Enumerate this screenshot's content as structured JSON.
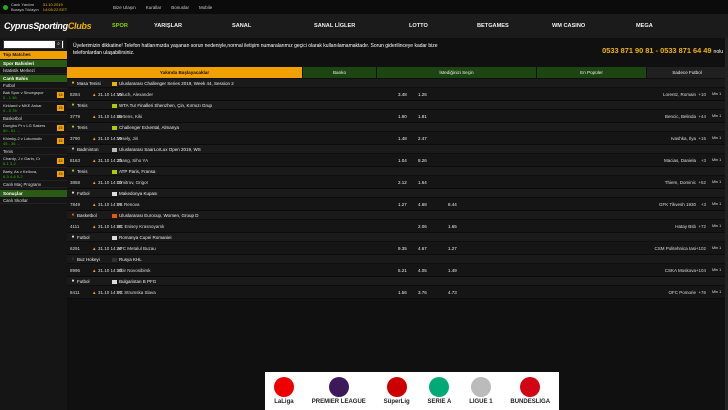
{
  "topbar": {
    "live_help_line1": "Canlı Yardım",
    "live_help_line2": "Buraya Tıklayın",
    "date": "31.10.2019",
    "time": "14:08:22 EET",
    "links": [
      "Bize Ulaşın",
      "Kurallar",
      "Bonuslar",
      "Mobile"
    ]
  },
  "header": {
    "logo_part1": "Cyprus",
    "logo_part2": "Sporting",
    "logo_part3": "Clubs",
    "nav": [
      "SPOR",
      "YARIŞLAR",
      "SANAL",
      "SANAL LİGLER",
      "LOTTO",
      "BETGAMES",
      "WM CASINO",
      "MEGA"
    ]
  },
  "sidebar": {
    "search_placeholder": "",
    "top_matches_label": "Top Matches",
    "top_items": [
      "Spor Bahisleri",
      "İstatistik Merkezi"
    ],
    "live_bets_label": "Canlı Bahis",
    "live_sport": "Futbol",
    "live_matches": [
      {
        "name": "Bak Spor v Sincegspor",
        "score": "0 - 1 36",
        "badge": "15"
      },
      {
        "name": "Kirkland v MKE Ankar",
        "score": "0 - 0 78",
        "badge": "15"
      },
      {
        "name": "Basketbol",
        "score": "",
        "badge": ""
      },
      {
        "name": "Dongbu Pr v LG Sakers",
        "score": "50 - 61 ...",
        "badge": "15"
      },
      {
        "name": "Khimky-2 v Lokomotiv",
        "score": "45 - 36 ...",
        "badge": "15"
      },
      {
        "name": "Tenis",
        "score": "",
        "badge": ""
      },
      {
        "name": "Chardy, J v Garin, Cr",
        "score": "6-1 3-2",
        "badge": "15"
      },
      {
        "name": "Barty, As v Keilova,",
        "score": "6-3 4-6 5-2",
        "badge": "15"
      }
    ],
    "live_program": "Canlı Maç Programı",
    "results_label": "Sonuçlar",
    "live_scores": "Canlı Skorlar"
  },
  "content": {
    "notice": "Üyelerimizin dikkatine! Telefon hatlarımızda yaşanan sorun nedeniyle,normal iletişim numaralarımız geçici olarak kullanılamamaktadır. Sorun giderilinceye kadar bize",
    "notice2": "telefonlardan ulaşabilirsiniz.",
    "phones": "0533 871 90 81 - 0533 871 64 49",
    "phones_suffix": "nolu",
    "tabs": [
      "Yakında Başlayacaklar",
      "Banko",
      "İstediğinizi Seçin",
      "En Popüler",
      "Sadece Futbol"
    ],
    "rows": [
      {
        "type": "league",
        "sport": "Masa Tenisi",
        "league": "Uluslararası Challenger Series 2019, Week 44, Session 2",
        "color": "#e8b400"
      },
      {
        "type": "match",
        "id": "8284",
        "date": "31.10 14:10",
        "home": "Valuch, Alexander",
        "o1": "3.48",
        "o2": "1.26",
        "ox": "",
        "away": "Lorentz, Romain",
        "count": "+10",
        "min": "Min 1"
      },
      {
        "type": "league",
        "sport": "Tenis",
        "league": "WTA Tur Finalleri Shenzhen, Çin, Kırmızı Grup",
        "color": "#aacc00"
      },
      {
        "type": "match",
        "id": "3779",
        "date": "31.10 14:10",
        "home": "Bertens, Kiki",
        "o1": "1.90",
        "o2": "1.81",
        "ox": "",
        "away": "Bencic, Belinda",
        "count": "+44",
        "min": "Min 1"
      },
      {
        "type": "league",
        "sport": "Tenis",
        "league": "Challenger Eckental, Almanya",
        "color": "#aacc00"
      },
      {
        "type": "match",
        "id": "3790",
        "date": "31.10 14:10",
        "home": "Vesely, Jiri",
        "o1": "1.48",
        "o2": "2.47",
        "ox": "",
        "away": "Ivashka, Ilya",
        "count": "+15",
        "min": "Min 1"
      },
      {
        "type": "league",
        "sport": "Badminton",
        "league": "Uluslararası SaarLorLux Open 2019, WS",
        "color": "#bbbbbb"
      },
      {
        "type": "match",
        "id": "8163",
        "date": "31.10 14:10",
        "home": "Zhang, Siho YA",
        "o1": "1.04",
        "o2": "8.26",
        "ox": "",
        "away": "Macias, Daniela",
        "count": "+3",
        "min": "Min 1"
      },
      {
        "type": "league",
        "sport": "Tenis",
        "league": "ATP Paris, Fransa",
        "color": "#aacc00"
      },
      {
        "type": "match",
        "id": "3858",
        "date": "31.10 14:10",
        "home": "Dimitrov, Grigor",
        "o1": "2.12",
        "o2": "1.64",
        "ox": "",
        "away": "Thiem, Dominic",
        "count": "+52",
        "min": "Min 1"
      },
      {
        "type": "league",
        "sport": "Futbol",
        "league": "Makedonya Kupası",
        "color": "#dddddd"
      },
      {
        "type": "match",
        "id": "7849",
        "date": "31.10 14:10",
        "home": "FK Renova",
        "o1": "1.27",
        "o2": "4.68",
        "ox": "8.44",
        "away": "GFK Tikvesh 1930",
        "count": "+3",
        "min": "Min 1"
      },
      {
        "type": "league",
        "sport": "Basketbol",
        "league": "Uluslararası Eurocup, Women, Group D",
        "color": "#e85a00"
      },
      {
        "type": "match",
        "id": "4111",
        "date": "31.10 14:10",
        "home": "BC Enisey Krasnoyarsk",
        "o1": "",
        "o2": "2.06",
        "ox": "1.65",
        "away": "Hatay Bsb",
        "count": "+72",
        "min": "Min 1"
      },
      {
        "type": "league",
        "sport": "Futbol",
        "league": "Romanya Cupei Romaniei",
        "color": "#dddddd"
      },
      {
        "type": "match",
        "id": "6291",
        "date": "31.10 14:10",
        "home": "AFC Metalul Buzau",
        "o1": "9.35",
        "o2": "4.67",
        "ox": "1.27",
        "away": "CSM Politehnica Iasi",
        "count": "+102",
        "min": "Min 1"
      },
      {
        "type": "league",
        "sport": "Buz Hokeyi",
        "league": "Rusya KHL",
        "color": "#333333"
      },
      {
        "type": "match",
        "id": "8996",
        "date": "31.10 14:10",
        "home": "Sibir Novosibirsk",
        "o1": "5.21",
        "o2": "4.05",
        "ox": "1.49",
        "away": "CSKA Moskova",
        "count": "+104",
        "min": "Min 1"
      },
      {
        "type": "league",
        "sport": "Futbol",
        "league": "Bulgaristan B PFG",
        "color": "#dddddd"
      },
      {
        "type": "match",
        "id": "8411",
        "date": "31.10 14:10",
        "home": "FC Strumska Slava",
        "o1": "1.56",
        "o2": "3.76",
        "ox": "4.73",
        "away": "OFC Pomorie",
        "count": "+76",
        "min": "Min 1"
      }
    ],
    "banner_logos": [
      {
        "name": "LaLiga",
        "color": "#e00"
      },
      {
        "name": "PREMIER LEAGUE",
        "color": "#3d195b"
      },
      {
        "name": "SüperLig",
        "color": "#c00"
      },
      {
        "name": "SERIE A",
        "color": "#0a7"
      },
      {
        "name": "LIGUE 1",
        "color": "#bbb"
      },
      {
        "name": "BUNDESLIGA",
        "color": "#d20515"
      }
    ]
  }
}
